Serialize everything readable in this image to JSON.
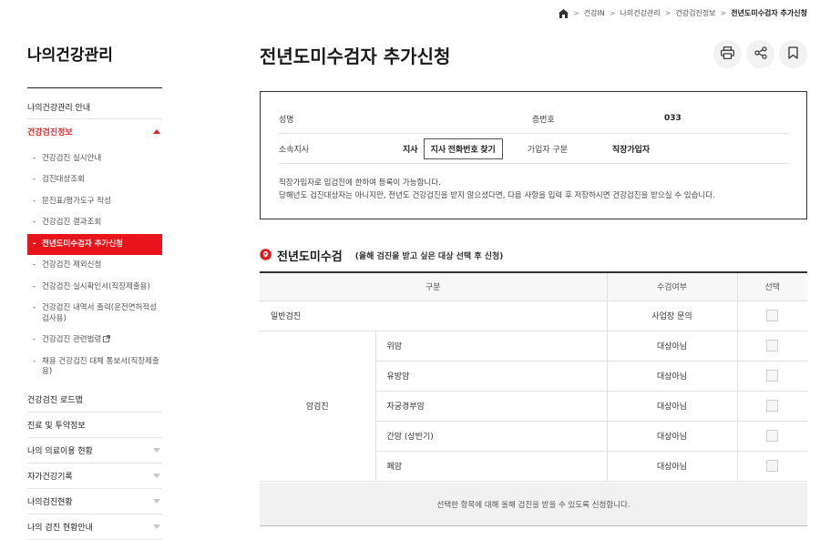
{
  "breadcrumb": [
    "건강IN",
    "나의건강관리",
    "건강검진정보",
    "전년도미수검자 추가신청"
  ],
  "sidebar": {
    "title": "나의건강관리",
    "top_item": "나의건강관리 안내",
    "active_section": "건강검진정보",
    "sub_items": [
      "건강검진 실시안내",
      "검진대상조회",
      "문진표/평가도구 작성",
      "건강검진 결과조회",
      "전년도미수검자 추가신청",
      "건강검진 제외신청",
      "건강검진 실시확인서(직장제출용)",
      "건강검진 내역서 출력(운전면허적성검사용)",
      "건강검진 관련법령",
      "채용 건강검진 대체 통보서(직장제출용)"
    ],
    "lower_items": [
      {
        "label": "건강검진 로드맵",
        "arrow": false
      },
      {
        "label": "진료 및 투약정보",
        "arrow": false
      },
      {
        "label": "나의 의료이용 현황",
        "arrow": true
      },
      {
        "label": "자가건강기록",
        "arrow": true
      },
      {
        "label": "나의검진현황",
        "arrow": true
      },
      {
        "label": "나의 검진 현황안내",
        "arrow": true
      }
    ]
  },
  "page": {
    "title": "전년도미수검자 추가신청",
    "tools": [
      "print-icon",
      "share-icon",
      "bookmark-icon"
    ]
  },
  "info": {
    "name_label": "성명",
    "name_value": "",
    "id_label": "증번호",
    "id_value": "033",
    "branch_label": "소속지사",
    "branch_value": "지사",
    "branch_button": "지사 전화번호 찾기",
    "type_label": "가입자 구분",
    "type_value": "직장가입자",
    "notice_1": "직장가입자로 입검진에 한하여 등록이 가능합니다.",
    "notice_2": "당해년도 검진대상자는 아니지만, 전년도 건강검진을 받지 않으셨다면, 다음 사항을 입력 후 저장하시면 건강검진을 받으실 수 있습니다."
  },
  "section": {
    "title": "전년도미수검",
    "subtitle": "(올해 검진을 받고 싶은 대상 선택 후 신청)"
  },
  "table": {
    "headers": [
      "구분",
      "수검여부",
      "선택"
    ],
    "general": {
      "label": "일반검진",
      "status": "사업장 문의"
    },
    "cancer_label": "암검진",
    "cancer_rows": [
      {
        "name": "위암",
        "status": "대상아님"
      },
      {
        "name": "유방암",
        "status": "대상아님"
      },
      {
        "name": "자궁경부암",
        "status": "대상아님"
      },
      {
        "name": "간암 (상반기)",
        "status": "대상아님"
      },
      {
        "name": "폐암",
        "status": "대상아님"
      }
    ],
    "footer": "선택한 항목에 대해 올해 검진을 받을 수 있도록 신청합니다."
  },
  "colors": {
    "accent": "#e8131b",
    "active_text": "#d62b2b"
  }
}
